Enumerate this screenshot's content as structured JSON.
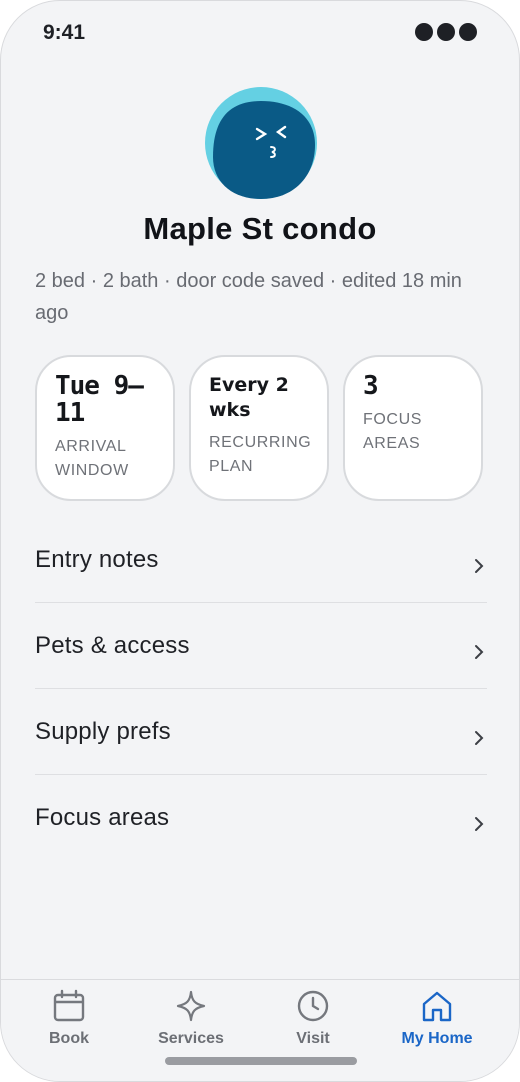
{
  "status": {
    "time": "9:41"
  },
  "profile": {
    "title": "Maple St condo",
    "subtitle": "2 bed · 2 bath · door code saved · edited 18 min ago",
    "avatar_icon": "winking-face-avatar"
  },
  "stats": [
    {
      "value": "Tue 9–11",
      "label": "ARRIVAL WINDOW"
    },
    {
      "value": "Every 2 wks",
      "label": "RECURRING PLAN"
    },
    {
      "value": "3",
      "label": "FOCUS AREAS"
    }
  ],
  "list": [
    {
      "label": "Entry notes"
    },
    {
      "label": "Pets & access"
    },
    {
      "label": "Supply prefs"
    },
    {
      "label": "Focus areas"
    }
  ],
  "tabs": [
    {
      "label": "Book",
      "icon": "calendar-icon",
      "active": false
    },
    {
      "label": "Services",
      "icon": "sparkle-icon",
      "active": false
    },
    {
      "label": "Visit",
      "icon": "clock-icon",
      "active": false
    },
    {
      "label": "My Home",
      "icon": "home-icon",
      "active": true
    }
  ],
  "colors": {
    "accent": "#1a66c7",
    "avatar_bg": "#64d0e3",
    "avatar_face": "#0a5a86",
    "background": "#f3f4f6"
  }
}
